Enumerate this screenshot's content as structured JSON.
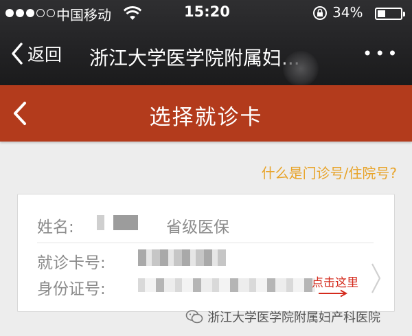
{
  "status_bar": {
    "carrier": "中国移动",
    "time": "15:20",
    "battery_percent": "34%",
    "battery_level": 0.34,
    "signal_full": 3,
    "signal_empty": 2
  },
  "wechat_header": {
    "back_label": "返回",
    "title": "浙江大学医学院附属妇...",
    "more": "•••"
  },
  "app_bar": {
    "title": "选择就诊卡"
  },
  "help_link": "什么是门诊号/住院号?",
  "card": {
    "name_label": "姓名:",
    "insurance": "省级医保",
    "card_no_label": "就诊卡号:",
    "id_no_label": "身份证号:",
    "click_here": "点击这里"
  },
  "watermark": "浙江大学医学院附属妇产科医院",
  "colors": {
    "app_bar": "#b33b1c",
    "help_link": "#e8a42a",
    "click_here": "#d42a1c"
  }
}
